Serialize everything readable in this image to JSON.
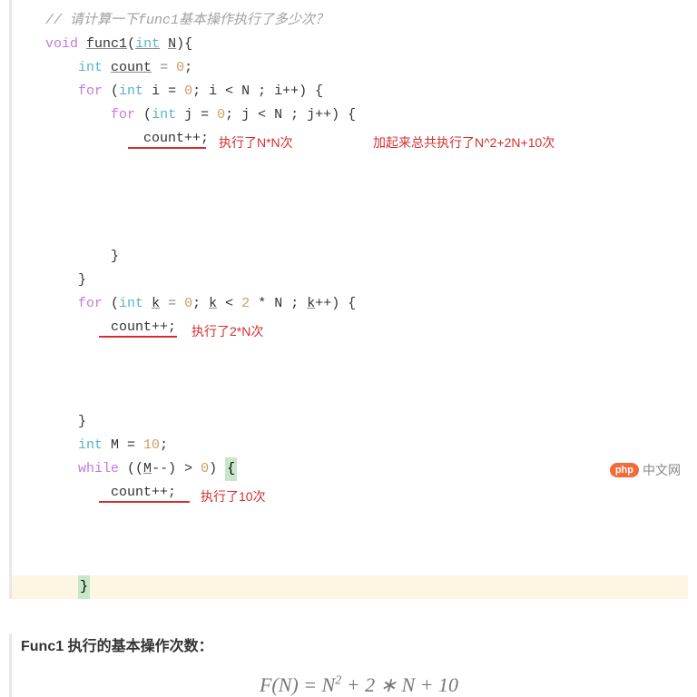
{
  "code": {
    "comment": "// 请计算一下func1基本操作执行了多少次？",
    "l1_void": "void",
    "l1_fn": "func1",
    "l1_open": "(",
    "l1_int": "int",
    "l1_param": "N",
    "l1_close": ")",
    "l1_brace": "{",
    "l2_int": "int",
    "l2_var": "count",
    "l2_eq": " = ",
    "l2_zero": "0",
    "l2_semi": ";",
    "l3_for": "for",
    "l3_open": " (",
    "l3_int": "int",
    "l3_i": " i = ",
    "l3_zero": "0",
    "l3_cond": "; i < N ; i++) {",
    "l4_for": "for",
    "l4_open": " (",
    "l4_int": "int",
    "l4_j": " j = ",
    "l4_zero": "0",
    "l4_cond": "; j < N ; j++) {",
    "l5_stmt": "count++;",
    "l6_brace": "}",
    "l7_brace": "}",
    "l8_for": "for",
    "l8_open": " (",
    "l8_int": "int",
    "l8_k": " ",
    "l8_kvar": "k",
    "l8_eq": " = ",
    "l8_zero": "0",
    "l8_semi": "; ",
    "l8_kvar2": "k",
    "l8_cond": " < ",
    "l8_two": "2",
    "l8_rest": " * N ; ",
    "l8_kvar3": "k",
    "l8_inc": "++) {",
    "l9_stmt": "count++;",
    "l10_brace": "}",
    "l11_int": "int",
    "l11_m": " M = ",
    "l11_ten": "10",
    "l11_semi": ";",
    "l12_while": "while",
    "l12_open": " ((",
    "l12_mvar": "M",
    "l12_dec": "--) > ",
    "l12_zero": "0",
    "l12_close": ") ",
    "l12_brace": "{",
    "l13_stmt": "count++;",
    "l14_brace": "}"
  },
  "annotations": {
    "nn": "执行了N*N次",
    "total": "加起来总共执行了N^2+2N+10次",
    "two_n": "执行了2*N次",
    "ten": "执行了10次"
  },
  "summary": {
    "title": "Func1 执行的基本操作次数：",
    "formula_lhs": "F(N) = N",
    "formula_exp": "2",
    "formula_rhs": " + 2 ∗ N + 10"
  },
  "watermark": {
    "badge": "php",
    "text": "中文网"
  }
}
